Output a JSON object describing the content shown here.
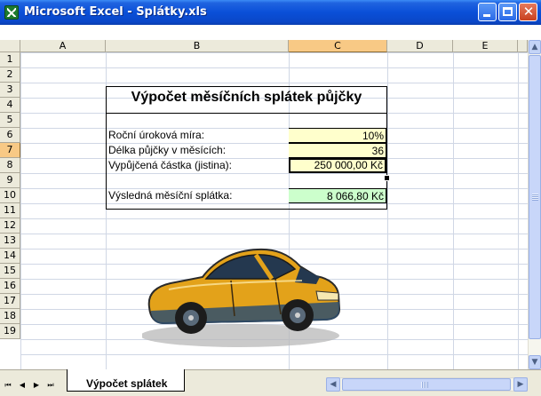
{
  "window": {
    "title": "Microsoft Excel - Splátky.xls"
  },
  "columns": [
    "A",
    "B",
    "C",
    "D",
    "E"
  ],
  "selected_column": "C",
  "rows": [
    "1",
    "2",
    "3",
    "4",
    "5",
    "6",
    "7",
    "8",
    "9",
    "10",
    "11",
    "12",
    "13",
    "14",
    "15",
    "16",
    "17",
    "18",
    "19"
  ],
  "selected_row": "7",
  "sheet": {
    "heading": "Výpočet měsíčních splátek půjčky",
    "fields": [
      {
        "label": "Roční úroková míra:",
        "value": "10%"
      },
      {
        "label": "Délka půjčky v měsících:",
        "value": "36"
      },
      {
        "label": "Vypůjčená částka (jistina):",
        "value": "250 000,00 Kč"
      }
    ],
    "result": {
      "label": "Výsledná měsíční splátka:",
      "value": "8 066,80 Kč"
    }
  },
  "tabs": [
    {
      "label": "Výpočet splátek",
      "active": true
    }
  ],
  "colors": {
    "input_fill": "#ffffcc",
    "result_fill": "#ccffcc",
    "selected_header": "#f8c985",
    "title_bar": "#0a4fd8"
  },
  "icons": [
    "excel-app-icon",
    "minimize-icon",
    "maximize-icon",
    "close-icon",
    "first-sheet-icon",
    "prev-sheet-icon",
    "next-sheet-icon",
    "last-sheet-icon",
    "scroll-up-icon",
    "scroll-down-icon",
    "scroll-left-icon",
    "scroll-right-icon",
    "car-clipart"
  ]
}
